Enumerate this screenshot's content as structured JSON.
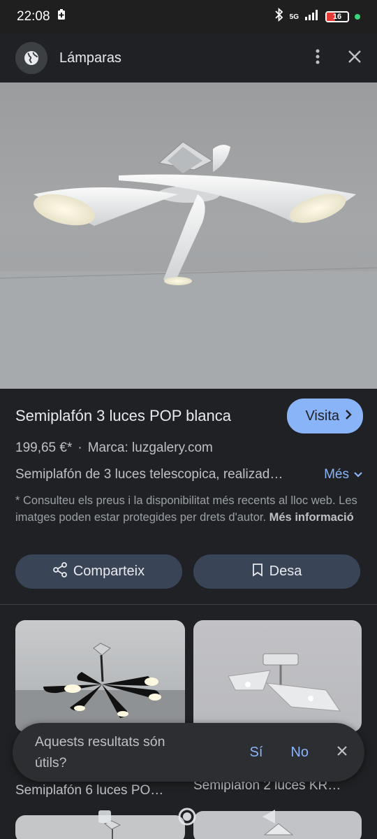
{
  "status_bar": {
    "time": "22:08",
    "network": "5G",
    "battery": "16"
  },
  "top_bar": {
    "title": "Lámparas"
  },
  "product": {
    "title": "Semiplafón 3 luces POP blanca",
    "visit_label": "Visita",
    "price": "199,65 €*",
    "separator": "·",
    "brand": "Marca: luzgalery.com",
    "description": "Semiplafón de 3 luces telescopica, realizad…",
    "more_label": "Més",
    "disclaimer": "* Consulteu els preus i la disponibilitat més recents al lloc web. Les imatges poden estar protegides per drets d'autor.",
    "more_info_label": "Més informació"
  },
  "actions": {
    "share_label": "Comparteix",
    "save_label": "Desa"
  },
  "related": {
    "items": [
      {
        "caption": "Semiplafón 6 luces PO…"
      },
      {
        "caption": "Semiplafón 2 luces KR…"
      }
    ]
  },
  "feedback_toast": {
    "question": "Aquests resultats són útils?",
    "yes_label": "Sí",
    "no_label": "No"
  },
  "colors": {
    "accent": "#8ab4f8",
    "background": "#202124",
    "pill": "#394457"
  }
}
